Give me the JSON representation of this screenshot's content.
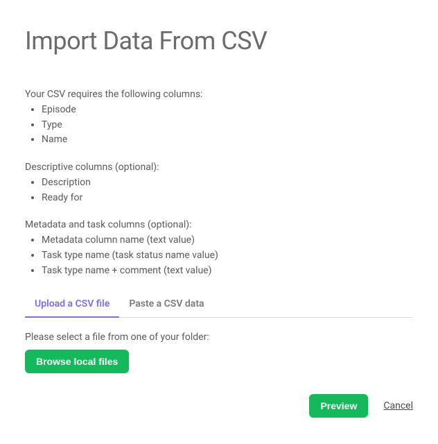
{
  "title": "Import Data From CSV",
  "required": {
    "intro": "Your CSV requires the following columns:",
    "items": [
      "Episode",
      "Type",
      "Name"
    ]
  },
  "descriptive": {
    "intro": "Descriptive columns (optional):",
    "items": [
      "Description",
      "Ready for"
    ]
  },
  "metadata": {
    "intro": "Metadata and task columns (optional):",
    "items": [
      "Metadata column name (text value)",
      "Task type name (task status name value)",
      "Task type name + comment (text value)"
    ]
  },
  "tabs": {
    "upload": "Upload a CSV file",
    "paste": "Paste a CSV data"
  },
  "file_section": {
    "instruction": "Please select a file from one of your folder:",
    "browse_label": "Browse local files"
  },
  "footer": {
    "preview": "Preview",
    "cancel": "Cancel"
  }
}
